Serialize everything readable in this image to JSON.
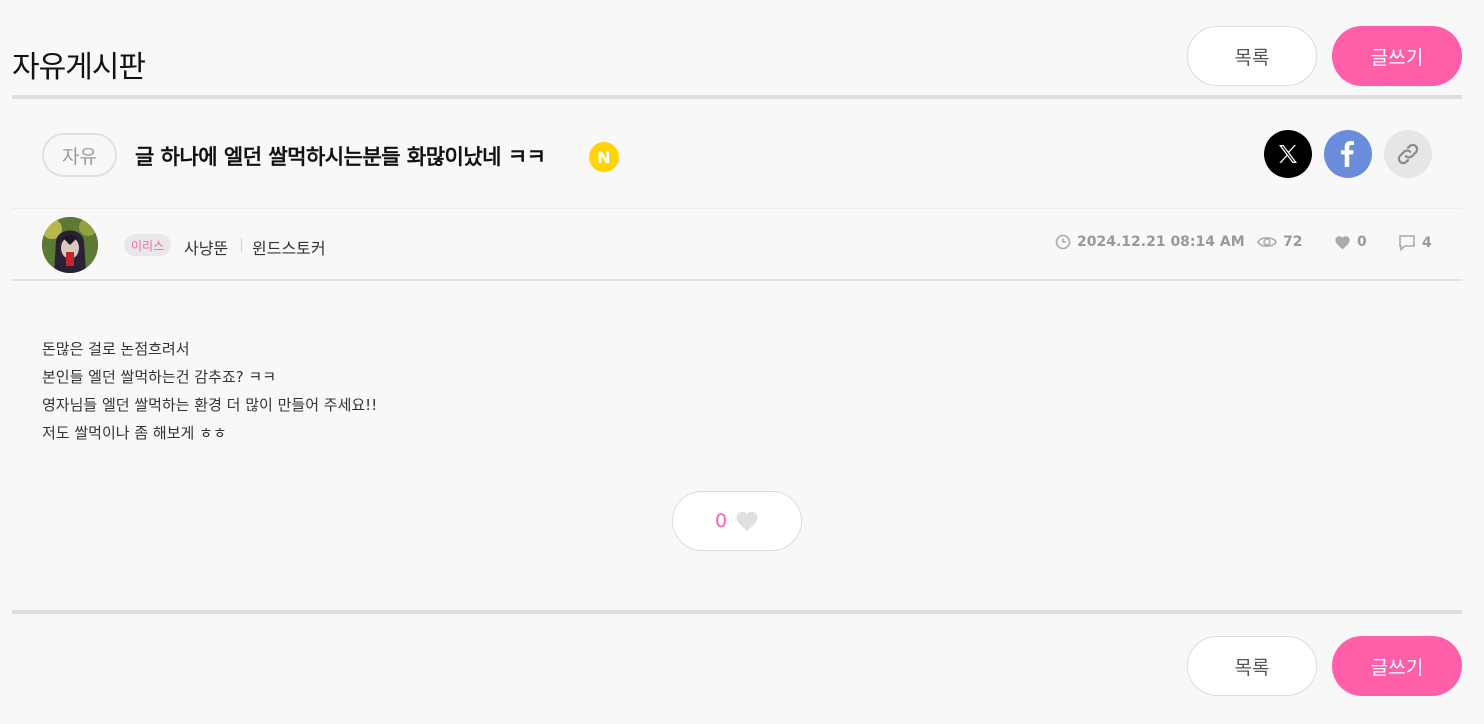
{
  "board": {
    "title": "자유게시판"
  },
  "buttons": {
    "list": "목록",
    "write": "글쓰기"
  },
  "post": {
    "category": "자유",
    "title": "글 하나에 엘던 쌀먹하시는분들 화많이났네 ㅋㅋ",
    "new_badge": "N"
  },
  "share": {
    "icons": [
      "x-icon",
      "facebook-icon",
      "link-icon"
    ],
    "colors": {
      "x": "#000000",
      "facebook": "#6a8ddb",
      "link": "#e6e6e6"
    }
  },
  "author": {
    "server": "이리스",
    "name": "사냥뚠",
    "job": "윈드스토커"
  },
  "meta": {
    "date": "2024.12.21 08:14 AM",
    "views": "72",
    "likes": "0",
    "comments": "4"
  },
  "content": {
    "lines": [
      "돈많은 걸로 논점흐려서",
      "본인들 엘던 쌀먹하는건 감추죠? ㅋㅋ",
      "영자님들 엘던 쌀먹하는 환경 더 많이 만들어 주세요!!",
      "저도 쌀먹이나 좀 해보게 ㅎㅎ"
    ]
  },
  "like_button": {
    "count": "0"
  },
  "colors": {
    "accent": "#ff5fa8",
    "badge": "#ffd400"
  }
}
